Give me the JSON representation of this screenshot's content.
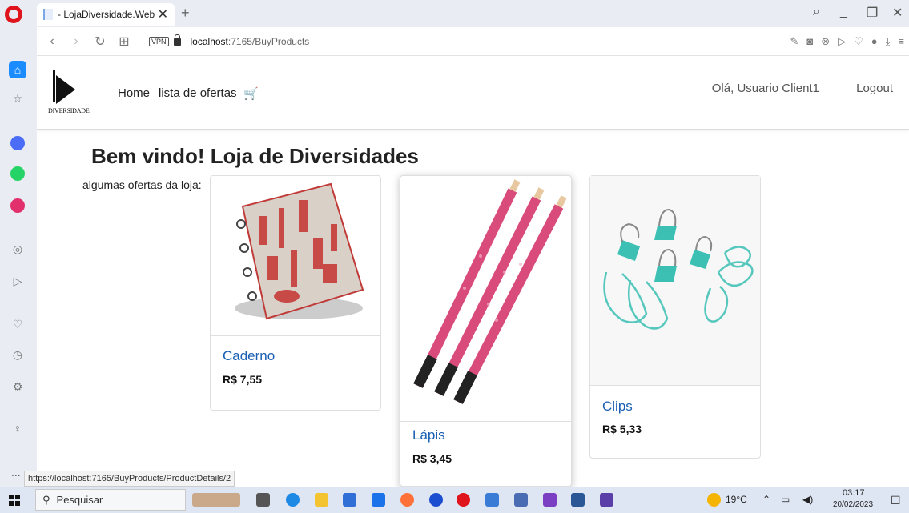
{
  "browser": {
    "tab_title": "- LojaDiversidade.Web",
    "tab_close": "✕",
    "new_tab": "+",
    "url_host": "localhost",
    "url_path": ":7165/BuyProducts",
    "vpn_label": "VPN",
    "status_url": "https://localhost:7165/BuyProducts/ProductDetails/2",
    "more_label": "..."
  },
  "site": {
    "logo_text": "DIVERSIDADE",
    "nav": {
      "home": "Home",
      "offers": "lista de ofertas"
    },
    "greeting": "Olá, Usuario Client1",
    "logout": "Logout",
    "heading": "Bem vindo! Loja de Diversidades",
    "offers_label": "algumas ofertas da loja:"
  },
  "products": [
    {
      "name": "Caderno",
      "price": "R$ 7,55"
    },
    {
      "name": "Lápis",
      "price": "R$ 3,45"
    },
    {
      "name": "Clips",
      "price": "R$ 5,33"
    }
  ],
  "taskbar": {
    "search_placeholder": "Pesquisar",
    "temperature": "19°C",
    "time": "03:17",
    "date": "20/02/2023"
  },
  "colors": {
    "accent": "#1a8cff",
    "link": "#1a5fb4",
    "opera": "#e0141c"
  }
}
